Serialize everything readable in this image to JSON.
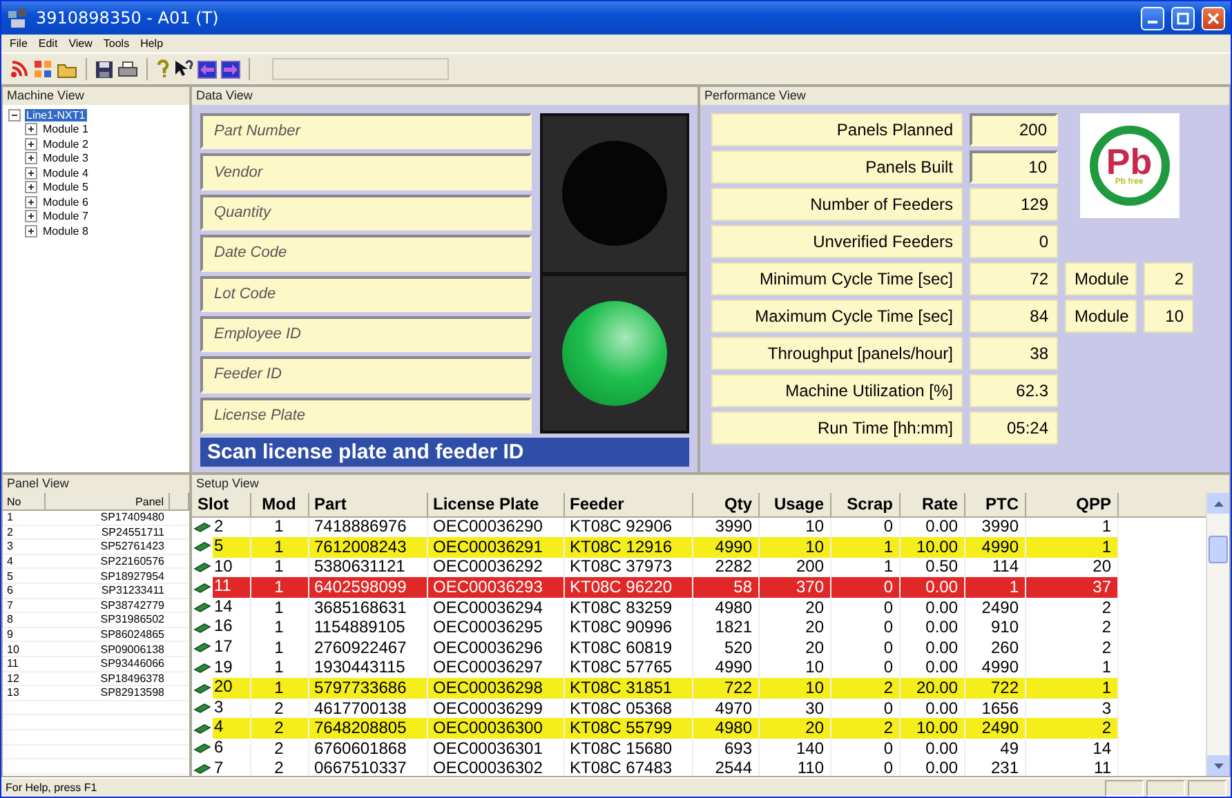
{
  "window": {
    "title": "3910898350 - A01 (T)"
  },
  "menu": [
    "File",
    "Edit",
    "View",
    "Tools",
    "Help"
  ],
  "machine_view": {
    "title": "Machine View",
    "tree": [
      {
        "label": "Line1-NXT1",
        "expanded": true,
        "selected": true,
        "children": [
          {
            "label": "Module 1",
            "expanded": false,
            "selected": false
          },
          {
            "label": "Module 2",
            "expanded": false,
            "selected": false
          },
          {
            "label": "Module 3",
            "expanded": false,
            "selected": false
          },
          {
            "label": "Module 4",
            "expanded": false,
            "selected": false
          },
          {
            "label": "Module 5",
            "expanded": false,
            "selected": false
          },
          {
            "label": "Module 6",
            "expanded": false,
            "selected": false
          },
          {
            "label": "Module 7",
            "expanded": false,
            "selected": false
          },
          {
            "label": "Module 8",
            "expanded": false,
            "selected": false
          }
        ]
      }
    ]
  },
  "data_view": {
    "title": "Data View",
    "fields": [
      {
        "placeholder": "Part Number"
      },
      {
        "placeholder": "Vendor"
      },
      {
        "placeholder": "Quantity"
      },
      {
        "placeholder": "Date Code"
      },
      {
        "placeholder": "Lot Code"
      },
      {
        "placeholder": "Employee ID"
      },
      {
        "placeholder": "Feeder ID"
      },
      {
        "placeholder": "License Plate"
      }
    ],
    "signal": {
      "top_lit": false,
      "bottom_lit": true
    },
    "prompt": "Scan license plate and feeder ID"
  },
  "performance_view": {
    "title": "Performance View",
    "metrics": [
      {
        "label": "Panels Planned",
        "value": "200",
        "editable": true
      },
      {
        "label": "Panels Built",
        "value": "10",
        "editable": true
      },
      {
        "label": "Number of Feeders",
        "value": "129",
        "editable": false
      },
      {
        "label": "Unverified Feeders",
        "value": "0",
        "editable": false
      },
      {
        "label": "Minimum Cycle Time [sec]",
        "value": "72",
        "editable": false,
        "module_label": "Module",
        "module_value": "2"
      },
      {
        "label": "Maximum Cycle Time [sec]",
        "value": "84",
        "editable": false,
        "module_label": "Module",
        "module_value": "10"
      },
      {
        "label": "Throughput [panels/hour]",
        "value": "38",
        "editable": false
      },
      {
        "label": "Machine Utilization [%]",
        "value": "62.3",
        "editable": false
      },
      {
        "label": "Run Time [hh:mm]",
        "value": "05:24",
        "editable": false
      }
    ],
    "logo": {
      "symbol": "Pb",
      "caption": "Pb free"
    }
  },
  "panel_view": {
    "title": "Panel View",
    "columns": [
      "No",
      "Panel"
    ],
    "rows": [
      [
        "1",
        "SP17409480"
      ],
      [
        "2",
        "SP24551711"
      ],
      [
        "3",
        "SP52761423"
      ],
      [
        "4",
        "SP22160576"
      ],
      [
        "5",
        "SP18927954"
      ],
      [
        "6",
        "SP31233411"
      ],
      [
        "7",
        "SP38742779"
      ],
      [
        "8",
        "SP31986502"
      ],
      [
        "9",
        "SP86024865"
      ],
      [
        "10",
        "SP09006138"
      ],
      [
        "11",
        "SP93446066"
      ],
      [
        "12",
        "SP18496378"
      ],
      [
        "13",
        "SP82913598"
      ]
    ]
  },
  "setup_view": {
    "title": "Setup View",
    "columns": [
      "Slot",
      "Mod",
      "Part",
      "License Plate",
      "Feeder",
      "Qty",
      "Usage",
      "Scrap",
      "Rate",
      "PTC",
      "QPP"
    ],
    "rows": [
      {
        "kind": "normal",
        "cells": [
          "2",
          "1",
          "7418886976",
          "OEC00036290",
          "KT08C 92906",
          "3990",
          "10",
          "0",
          "0.00",
          "3990",
          "1"
        ]
      },
      {
        "kind": "warning",
        "cells": [
          "5",
          "1",
          "7612008243",
          "OEC00036291",
          "KT08C 12916",
          "4990",
          "10",
          "1",
          "10.00",
          "4990",
          "1"
        ]
      },
      {
        "kind": "normal",
        "cells": [
          "10",
          "1",
          "5380631121",
          "OEC00036292",
          "KT08C 37973",
          "2282",
          "200",
          "1",
          "0.50",
          "114",
          "20"
        ]
      },
      {
        "kind": "error",
        "cells": [
          "11",
          "1",
          "6402598099",
          "OEC00036293",
          "KT08C 96220",
          "58",
          "370",
          "0",
          "0.00",
          "1",
          "37"
        ]
      },
      {
        "kind": "normal",
        "cells": [
          "14",
          "1",
          "3685168631",
          "OEC00036294",
          "KT08C 83259",
          "4980",
          "20",
          "0",
          "0.00",
          "2490",
          "2"
        ]
      },
      {
        "kind": "normal",
        "cells": [
          "16",
          "1",
          "1154889105",
          "OEC00036295",
          "KT08C 90996",
          "1821",
          "20",
          "0",
          "0.00",
          "910",
          "2"
        ]
      },
      {
        "kind": "normal",
        "cells": [
          "17",
          "1",
          "2760922467",
          "OEC00036296",
          "KT08C 60819",
          "520",
          "20",
          "0",
          "0.00",
          "260",
          "2"
        ]
      },
      {
        "kind": "normal",
        "cells": [
          "19",
          "1",
          "1930443115",
          "OEC00036297",
          "KT08C 57765",
          "4990",
          "10",
          "0",
          "0.00",
          "4990",
          "1"
        ]
      },
      {
        "kind": "warning",
        "cells": [
          "20",
          "1",
          "5797733686",
          "OEC00036298",
          "KT08C 31851",
          "722",
          "10",
          "2",
          "20.00",
          "722",
          "1"
        ]
      },
      {
        "kind": "normal",
        "cells": [
          "3",
          "2",
          "4617700138",
          "OEC00036299",
          "KT08C 05368",
          "4970",
          "30",
          "0",
          "0.00",
          "1656",
          "3"
        ]
      },
      {
        "kind": "warning",
        "cells": [
          "4",
          "2",
          "7648208805",
          "OEC00036300",
          "KT08C 55799",
          "4980",
          "20",
          "2",
          "10.00",
          "2490",
          "2"
        ]
      },
      {
        "kind": "normal",
        "cells": [
          "6",
          "2",
          "6760601868",
          "OEC00036301",
          "KT08C 15680",
          "693",
          "140",
          "0",
          "0.00",
          "49",
          "14"
        ]
      },
      {
        "kind": "normal",
        "cells": [
          "7",
          "2",
          "0667510337",
          "OEC00036302",
          "KT08C 67483",
          "2544",
          "110",
          "0",
          "0.00",
          "231",
          "11"
        ]
      }
    ]
  },
  "status_bar": {
    "text": "For Help, press F1"
  }
}
